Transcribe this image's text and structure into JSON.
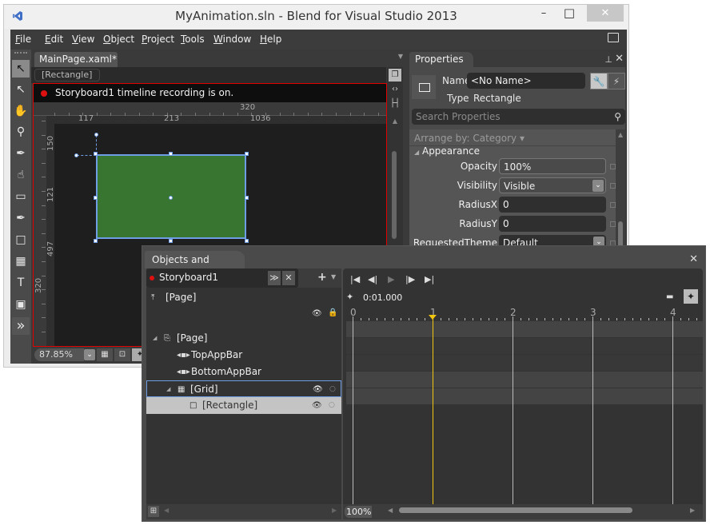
{
  "window": {
    "title": "MyAnimation.sln - Blend for Visual Studio 2013",
    "minimize": "–",
    "maximize": "□",
    "close": "✕"
  },
  "menu": [
    {
      "label": "File",
      "accel": "F",
      "rest": "ile"
    },
    {
      "label": "Edit",
      "accel": "E",
      "rest": "dit"
    },
    {
      "label": "View",
      "accel": "V",
      "rest": "iew"
    },
    {
      "label": "Object",
      "accel": "O",
      "rest": "bject"
    },
    {
      "label": "Project",
      "accel": "P",
      "rest": "roject"
    },
    {
      "label": "Tools",
      "accel": "T",
      "rest": "ools"
    },
    {
      "label": "Window",
      "accel": "W",
      "rest": "indow"
    },
    {
      "label": "Help",
      "accel": "H",
      "rest": "elp"
    }
  ],
  "toolbox": {
    "tools": [
      {
        "name": "selection-tool",
        "glyph": "↖"
      },
      {
        "name": "direct-selection-tool",
        "glyph": "↖"
      },
      {
        "name": "pan-tool",
        "glyph": "✋"
      },
      {
        "name": "zoom-tool",
        "glyph": "⚲"
      },
      {
        "name": "eyedropper-tool",
        "glyph": "✒"
      },
      {
        "name": "paint-bucket-tool",
        "glyph": "☝"
      },
      {
        "name": "eraser-tool",
        "glyph": "▭"
      },
      {
        "name": "pen-tool",
        "glyph": "✒"
      },
      {
        "name": "rectangle-tool",
        "glyph": "□"
      },
      {
        "name": "grid-tool",
        "glyph": "▦"
      },
      {
        "name": "text-tool",
        "glyph": "T"
      },
      {
        "name": "control-tool",
        "glyph": "▣"
      },
      {
        "name": "assets-tool",
        "glyph": "»"
      }
    ]
  },
  "document": {
    "tab_label": "MainPage.xaml*",
    "tab_close": "✕",
    "breadcrumb": "[Rectangle]",
    "recording_message": "Storyboard1 timeline recording is on.",
    "ruler": {
      "top_label": "320",
      "h_labels": [
        "117",
        "213",
        "1036"
      ],
      "v_labels": [
        "150",
        "121",
        "497"
      ],
      "left_label": "320"
    },
    "rect_fill": "#377530",
    "zoom_level": "87.85%"
  },
  "properties": {
    "title": "Properties",
    "name_label": "Name",
    "name_value": "<No Name>",
    "type_label": "Type",
    "type_value": "Rectangle",
    "search_placeholder": "Search Properties",
    "arrange_by": "Arrange by: Category ▾",
    "category": "Appearance",
    "rows": [
      {
        "label": "Opacity",
        "value": "100%",
        "dropdown": false
      },
      {
        "label": "Visibility",
        "value": "Visible",
        "dropdown": true
      },
      {
        "label": "RadiusX",
        "value": "0",
        "dropdown": false
      },
      {
        "label": "RadiusY",
        "value": "0",
        "dropdown": false
      },
      {
        "label": "RequestedTheme",
        "value": "Default",
        "dropdown": true
      }
    ]
  },
  "objects_timeline": {
    "title": "Objects and Timeline",
    "storyboard": "Storyboard1",
    "scope_up": "[Page]",
    "tree": [
      {
        "label": "[Page]",
        "level": 0,
        "expander": true,
        "icon": "page-icon"
      },
      {
        "label": "TopAppBar",
        "level": 1,
        "expander": false,
        "icon": "appbar-icon"
      },
      {
        "label": "BottomAppBar",
        "level": 1,
        "expander": false,
        "icon": "appbar-icon"
      },
      {
        "label": "[Grid]",
        "level": 1,
        "expander": true,
        "icon": "grid-icon",
        "state": "outlined"
      },
      {
        "label": "[Rectangle]",
        "level": 2,
        "expander": false,
        "icon": "rectangle-icon",
        "state": "selected"
      }
    ],
    "time": "0:01.000",
    "ruler_seconds": [
      "0",
      "1",
      "2",
      "3",
      "4"
    ],
    "playhead_seconds": 1,
    "zoom": "100%"
  }
}
